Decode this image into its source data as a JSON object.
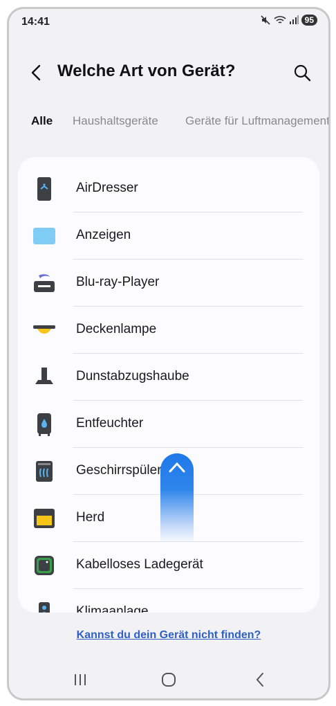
{
  "status": {
    "time": "14:41",
    "battery": "95"
  },
  "header": {
    "title": "Welche Art von Gerät?"
  },
  "tabs": [
    {
      "label": "Alle",
      "active": true
    },
    {
      "label": "Haushaltsgeräte",
      "active": false
    },
    {
      "label": "Geräte für Luftmanagement",
      "active": false
    }
  ],
  "devices": [
    {
      "label": "AirDresser",
      "icon": "airdresser-icon"
    },
    {
      "label": "Anzeigen",
      "icon": "display-icon"
    },
    {
      "label": "Blu-ray-Player",
      "icon": "bluray-player-icon"
    },
    {
      "label": "Deckenlampe",
      "icon": "ceiling-lamp-icon"
    },
    {
      "label": "Dunstabzugshaube",
      "icon": "range-hood-icon"
    },
    {
      "label": "Entfeuchter",
      "icon": "dehumidifier-icon"
    },
    {
      "label": "Geschirrspüler",
      "icon": "dishwasher-icon"
    },
    {
      "label": "Herd",
      "icon": "oven-icon"
    },
    {
      "label": "Kabelloses Ladegerät",
      "icon": "wireless-charger-icon"
    },
    {
      "label": "Klimaanlage",
      "icon": "air-conditioner-icon"
    }
  ],
  "footer": {
    "link": "Kannst du dein Gerät nicht finden?"
  }
}
